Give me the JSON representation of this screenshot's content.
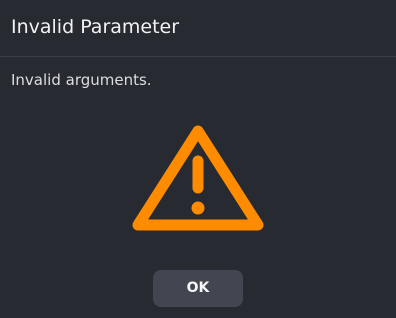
{
  "dialog": {
    "title": "Invalid Parameter",
    "message": "Invalid arguments.",
    "icon": "warning-triangle-icon",
    "ok_label": "OK"
  },
  "colors": {
    "background": "#282a31",
    "divider": "#3b3e47",
    "accent": "#ff8c00",
    "button_background": "#434651",
    "text": "#e9eaee"
  }
}
